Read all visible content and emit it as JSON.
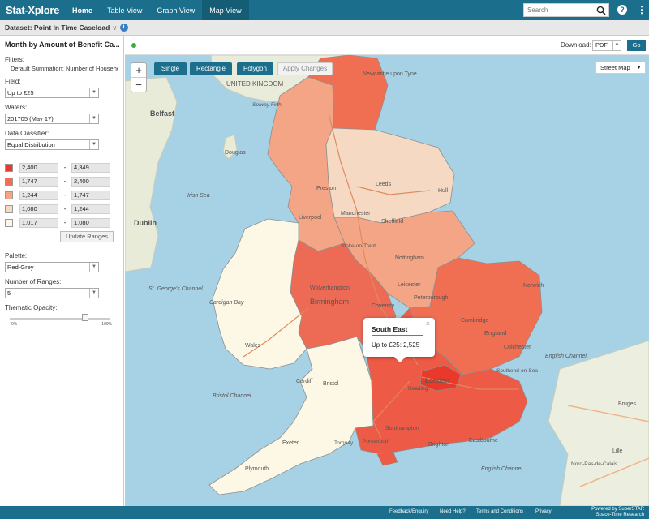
{
  "app": {
    "brand": "Stat-Xplore",
    "nav": [
      {
        "label": "Home"
      },
      {
        "label": "Table View"
      },
      {
        "label": "Graph View"
      },
      {
        "label": "Map View"
      }
    ],
    "search_placeholder": "Search",
    "help_symbol": "?",
    "more_symbol": "⋮",
    "accent_color": "#1b6f8c"
  },
  "dataset": {
    "label": "Dataset: Point In Time Caseload",
    "chevron": "∨",
    "info": "i"
  },
  "sidebar": {
    "title": "Month by Amount of Benefit Ca...",
    "filters_label": "Filters:",
    "filters_text": "Default Summation: Number of Households",
    "field_label": "Field:",
    "field_value": "Up to £25",
    "wafers_label": "Wafers:",
    "wafers_value": "201705 (May 17)",
    "classifier_label": "Data Classifier:",
    "classifier_value": "Equal Distribution",
    "ranges": [
      {
        "color": "#e8392a",
        "from": "2,400",
        "to": "4,349"
      },
      {
        "color": "#f06f52",
        "from": "1,747",
        "to": "2,400"
      },
      {
        "color": "#f3a585",
        "from": "1,244",
        "to": "1,747"
      },
      {
        "color": "#f6d9c3",
        "from": "1,080",
        "to": "1,244"
      },
      {
        "color": "#fdf8e6",
        "from": "1,017",
        "to": "1,080"
      }
    ],
    "range_separator": "-",
    "update_button": "Update Ranges",
    "palette_label": "Palette:",
    "palette_value": "Red-Grey",
    "num_ranges_label": "Number of Ranges:",
    "num_ranges_value": "5",
    "opacity_label": "Thematic Opacity:",
    "opacity_min": "0%",
    "opacity_max": "100%",
    "opacity_level": 0.75
  },
  "map": {
    "download_label": "Download:",
    "download_format": "PDF",
    "go_button": "Go",
    "zoom_in": "+",
    "zoom_out": "−",
    "tools": [
      "Single",
      "Rectangle",
      "Polygon"
    ],
    "apply_changes": "Apply Changes",
    "layer": "Street Map",
    "popup": {
      "title": "South East",
      "value": "Up to £25: 2,525",
      "close": "×"
    },
    "place_labels": {
      "belfast": "Belfast",
      "dublin": "Dublin",
      "douglas": "Douglas",
      "irish_sea": "Irish Sea",
      "solway": "Solway Firth",
      "uk": "UNITED KINGDOM",
      "newcastle": "Newcastle upon Tyne",
      "leeds": "Leeds",
      "hull": "Hull",
      "preston": "Preston",
      "liverpool": "Liverpool",
      "manchester": "Manchester",
      "sheffield": "Sheffield",
      "stoke": "Stoke-on-Trent",
      "nottingham": "Nottingham",
      "leicester": "Leicester",
      "peterborough": "Peterborough",
      "norwich": "Norwich",
      "wolverhampton": "Wolverhampton",
      "birmingham": "Birmingham",
      "coventry": "Coventry",
      "cambridge": "Cambridge",
      "england": "England",
      "colchester": "Colchester",
      "southend": "Southend-on-Sea",
      "london": "London",
      "reading": "Reading",
      "cardigan": "Cardigan Bay",
      "st_georges": "St. George's Channel",
      "wales": "Wales",
      "bristol": "Bristol",
      "cardiff": "Cardiff",
      "bristol_channel": "Bristol Channel",
      "southampton": "Southampton",
      "portsmouth": "Portsmouth",
      "brighton": "Brighton",
      "eastbourne": "Eastbourne",
      "english_channel": "English Channel",
      "english_channel_2": "English Channel",
      "plymouth": "Plymouth",
      "torquay": "Torquay",
      "bruges": "Bruges",
      "lille": "Lille",
      "nord": "Nord-Pas-de-Calais",
      "exeter": "Exeter"
    }
  },
  "footer": {
    "links": [
      "Feedback/Enquiry",
      "Need Help?",
      "Terms and Conditions",
      "Privacy"
    ],
    "powered_line1": "Powered by SuperSTAR",
    "powered_line2": "Space-Time Research"
  }
}
